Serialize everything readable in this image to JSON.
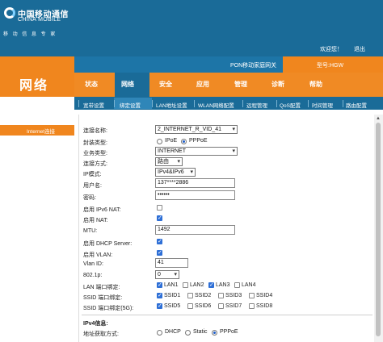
{
  "brand": {
    "name_cn": "中国移动通信",
    "name_en": "CHINA MOBILE",
    "slogan": "移 动 信 息 专 家"
  },
  "header": {
    "welcome": "欢迎您！",
    "logout": "退出",
    "gateway_type": "PON移动家庭网关",
    "model": "型号:HGW"
  },
  "section_title": "网络",
  "nav": {
    "items": [
      "状态",
      "网络",
      "安全",
      "应用",
      "管理",
      "诊断",
      "帮助"
    ],
    "active": "网络"
  },
  "subnav": {
    "items": [
      "宽带设置",
      "绑定设置",
      "LAN地址设置",
      "WLAN网络配置",
      "远程管理",
      "QoS配置",
      "时间管理",
      "路由配置"
    ],
    "active": "绑定设置"
  },
  "left_menu": {
    "item": "Internet连接"
  },
  "form": {
    "connection_name": {
      "label": "连接名称:",
      "value": "2_INTERNET_R_VID_41"
    },
    "encap_type": {
      "label": "封装类型:",
      "options": [
        "IPoE",
        "PPPoE"
      ],
      "selected": "PPPoE"
    },
    "service_type": {
      "label": "业务类型:",
      "value": "INTERNET"
    },
    "connection_mode": {
      "label": "连接方式:",
      "value": "路由"
    },
    "ip_mode": {
      "label": "IP模式:",
      "value": "IPv4&IPv6"
    },
    "username": {
      "label": "用户名:",
      "value": "137****2886"
    },
    "password": {
      "label": "密码:",
      "value": "••••••"
    },
    "enable_ipv6_nat": {
      "label": "启用 IPv6 NAT:",
      "checked": false
    },
    "enable_nat": {
      "label": "启用 NAT:",
      "checked": true
    },
    "mtu": {
      "label": "MTU:",
      "value": "1492"
    },
    "enable_dhcp_server": {
      "label": "启用 DHCP Server:",
      "checked": true
    },
    "enable_vlan": {
      "label": "启用 VLAN:",
      "checked": true
    },
    "vlan_id": {
      "label": "Vlan ID:",
      "value": "41"
    },
    "dot1p": {
      "label": "802.1p:",
      "value": "0"
    },
    "lan_binding": {
      "label": "LAN 端口绑定:",
      "ports": [
        {
          "name": "LAN1",
          "checked": true
        },
        {
          "name": "LAN2",
          "checked": false
        },
        {
          "name": "LAN3",
          "checked": true
        },
        {
          "name": "LAN4",
          "checked": false
        }
      ]
    },
    "ssid_binding": {
      "label": "SSID 端口绑定:",
      "ports": [
        {
          "name": "SSID1",
          "checked": true
        },
        {
          "name": "SSID2",
          "checked": false
        },
        {
          "name": "SSID3",
          "checked": false
        },
        {
          "name": "SSID4",
          "checked": false
        }
      ]
    },
    "ssid5g_binding": {
      "label": "SSID 端口绑定(5G):",
      "ports": [
        {
          "name": "SSID5",
          "checked": true
        },
        {
          "name": "SSID6",
          "checked": false
        },
        {
          "name": "SSID7",
          "checked": false
        },
        {
          "name": "SSID8",
          "checked": false
        }
      ]
    },
    "ipv4_info_title": "IPv4信息:",
    "addr_mode": {
      "label": "地址获取方式:",
      "options": [
        "DHCP",
        "Static",
        "PPPoE"
      ],
      "selected": "PPPoE"
    }
  },
  "colors": {
    "header_blue": "#1a6b98",
    "accent_orange": "#f0861e",
    "checkbox_blue": "#2e6fd6"
  }
}
